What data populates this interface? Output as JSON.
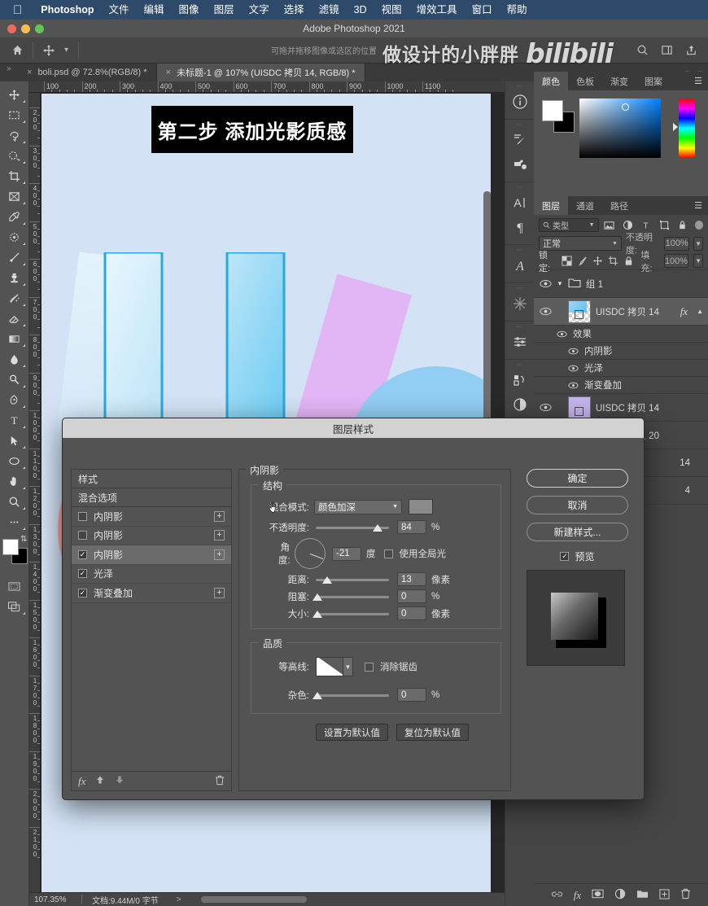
{
  "macmenu": {
    "apple": "apple-logo",
    "items": [
      "Photoshop",
      "文件",
      "编辑",
      "图像",
      "图层",
      "文字",
      "选择",
      "滤镜",
      "3D",
      "视图",
      "增效工具",
      "窗口",
      "帮助"
    ]
  },
  "window": {
    "title": "Adobe Photoshop 2021"
  },
  "watermark": {
    "cn": "做设计的小胖胖",
    "brand": "bilibili"
  },
  "optionsbar": {
    "home_icon": "home-icon",
    "move_tool_icon": "move-tool-icon",
    "hint": "可拖并拖移图像或选区的位置",
    "search_icon": "search-icon",
    "workspace_icon": "workspace-icon",
    "share_icon": "share-icon"
  },
  "tabs": [
    {
      "label": "boli.psd @ 72.8%(RGB/8) *",
      "active": false
    },
    {
      "label": "未标题-1 @ 107% (UISDC 拷贝 14, RGB/8) *",
      "active": true
    }
  ],
  "toolbar": {
    "tools": [
      "move-tool",
      "marquee-tool",
      "lasso-tool",
      "quick-select-tool",
      "crop-tool",
      "frame-tool",
      "eyedropper-tool",
      "healing-brush-tool",
      "brush-tool",
      "clone-stamp-tool",
      "history-brush-tool",
      "eraser-tool",
      "gradient-tool",
      "blur-tool",
      "dodge-tool",
      "pen-tool",
      "type-tool",
      "path-select-tool",
      "shape-tool",
      "hand-tool",
      "zoom-tool",
      "more-tools"
    ],
    "foreground": "#ffffff",
    "background": "#000000"
  },
  "canvas": {
    "banner_text": "第二步 添加光影质感",
    "ruler_h": [
      "100",
      "200",
      "300",
      "400",
      "500",
      "600",
      "700",
      "800",
      "900",
      "1000",
      "1100"
    ],
    "ruler_v": [
      "200",
      "300",
      "400",
      "500",
      "600",
      "700",
      "800",
      "900",
      "1000",
      "1100",
      "1200",
      "1300",
      "1400",
      "1500",
      "1600",
      "1700",
      "1800",
      "1900",
      "2000",
      "2100"
    ]
  },
  "statusbar": {
    "zoom": "107.35%",
    "doc": "文档:9.44M/0 字节",
    "arrow": ">"
  },
  "rail": {
    "icons": [
      "info-icon",
      "brush-settings-icon",
      "brush-presets-icon",
      "character-icon",
      "paragraph-icon",
      "glyphs-icon",
      "actions-icon",
      "adjustments-icon",
      "history-icon",
      "properties-icon"
    ]
  },
  "color_panel": {
    "tabs": [
      "颜色",
      "色板",
      "渐变",
      "图案"
    ],
    "active_tab": "颜色",
    "menu_icon": "panel-menu-icon",
    "foreground": "#ffffff",
    "background": "#000000"
  },
  "layers_panel": {
    "tabs": [
      "图层",
      "通道",
      "路径"
    ],
    "active_tab": "图层",
    "menu_icon": "panel-menu-icon",
    "filter_placeholder": "类型",
    "filter_icons": [
      "filter-pixel-icon",
      "filter-adjustment-icon",
      "filter-type-icon",
      "filter-shape-icon",
      "filter-smart-icon"
    ],
    "blend_mode": "正常",
    "opacity_label": "不透明度:",
    "opacity_value": "100%",
    "lock_label": "锁定:",
    "fill_label": "填充:",
    "fill_value": "100%",
    "lock_icons": [
      "lock-transparent-icon",
      "lock-image-icon",
      "lock-position-icon",
      "lock-artboard-icon",
      "lock-all-icon"
    ],
    "rows": [
      {
        "type": "group",
        "name": "组 1",
        "visible": true
      },
      {
        "type": "layer",
        "name": "UISDC 拷贝 14",
        "visible": true,
        "selected": true,
        "fx": "fx"
      },
      {
        "type": "effect-head",
        "name": "效果"
      },
      {
        "type": "effect",
        "name": "内阴影"
      },
      {
        "type": "effect",
        "name": "光泽"
      },
      {
        "type": "effect",
        "name": "渐变叠加"
      },
      {
        "type": "layer",
        "name": "UISDC 拷贝 14",
        "visible": true
      },
      {
        "type": "layer",
        "name": "UISDC 拷贝 20",
        "visible": true
      }
    ],
    "hidden_rows": [
      {
        "name": "14"
      },
      {
        "name": "4"
      }
    ],
    "bottom_icons": [
      "link-icon",
      "fx-icon",
      "mask-icon",
      "adjustment-icon",
      "group-icon",
      "new-layer-icon",
      "delete-icon"
    ]
  },
  "dialog": {
    "title": "图层样式",
    "styles_header": "样式",
    "blending_options": "混合选项",
    "style_items": [
      {
        "label": "内阴影",
        "checked": false,
        "has_plus": true,
        "selected": false
      },
      {
        "label": "内阴影",
        "checked": false,
        "has_plus": true,
        "selected": false
      },
      {
        "label": "内阴影",
        "checked": true,
        "has_plus": true,
        "selected": true
      },
      {
        "label": "光泽",
        "checked": true,
        "has_plus": false,
        "selected": false
      },
      {
        "label": "渐变叠加",
        "checked": true,
        "has_plus": true,
        "selected": false
      }
    ],
    "styles_footer_icons": [
      "fx-icon",
      "move-up-icon",
      "move-down-icon",
      "delete-icon"
    ],
    "section_title": "内阴影",
    "structure": {
      "legend": "结构",
      "blend_mode_label": "混合模式:",
      "blend_mode_value": "颜色加深",
      "shadow_color": "#8a8a8a",
      "opacity_label": "不透明度:",
      "opacity_value": "84",
      "opacity_unit": "%",
      "angle_label": "角度:",
      "angle_value": "-21",
      "angle_unit": "度",
      "global_light_label": "使用全局光",
      "global_light_checked": false,
      "distance_label": "距离:",
      "distance_value": "13",
      "distance_unit": "像素",
      "choke_label": "阻塞:",
      "choke_value": "0",
      "choke_unit": "%",
      "size_label": "大小:",
      "size_value": "0",
      "size_unit": "像素"
    },
    "quality": {
      "legend": "品质",
      "contour_label": "等高线:",
      "antialias_label": "消除锯齿",
      "antialias_checked": false,
      "noise_label": "杂色:",
      "noise_value": "0",
      "noise_unit": "%"
    },
    "default_buttons": [
      "设置为默认值",
      "复位为默认值"
    ],
    "ok_label": "确定",
    "cancel_label": "取消",
    "newstyle_label": "新建样式...",
    "preview_label": "预览",
    "preview_checked": true
  }
}
